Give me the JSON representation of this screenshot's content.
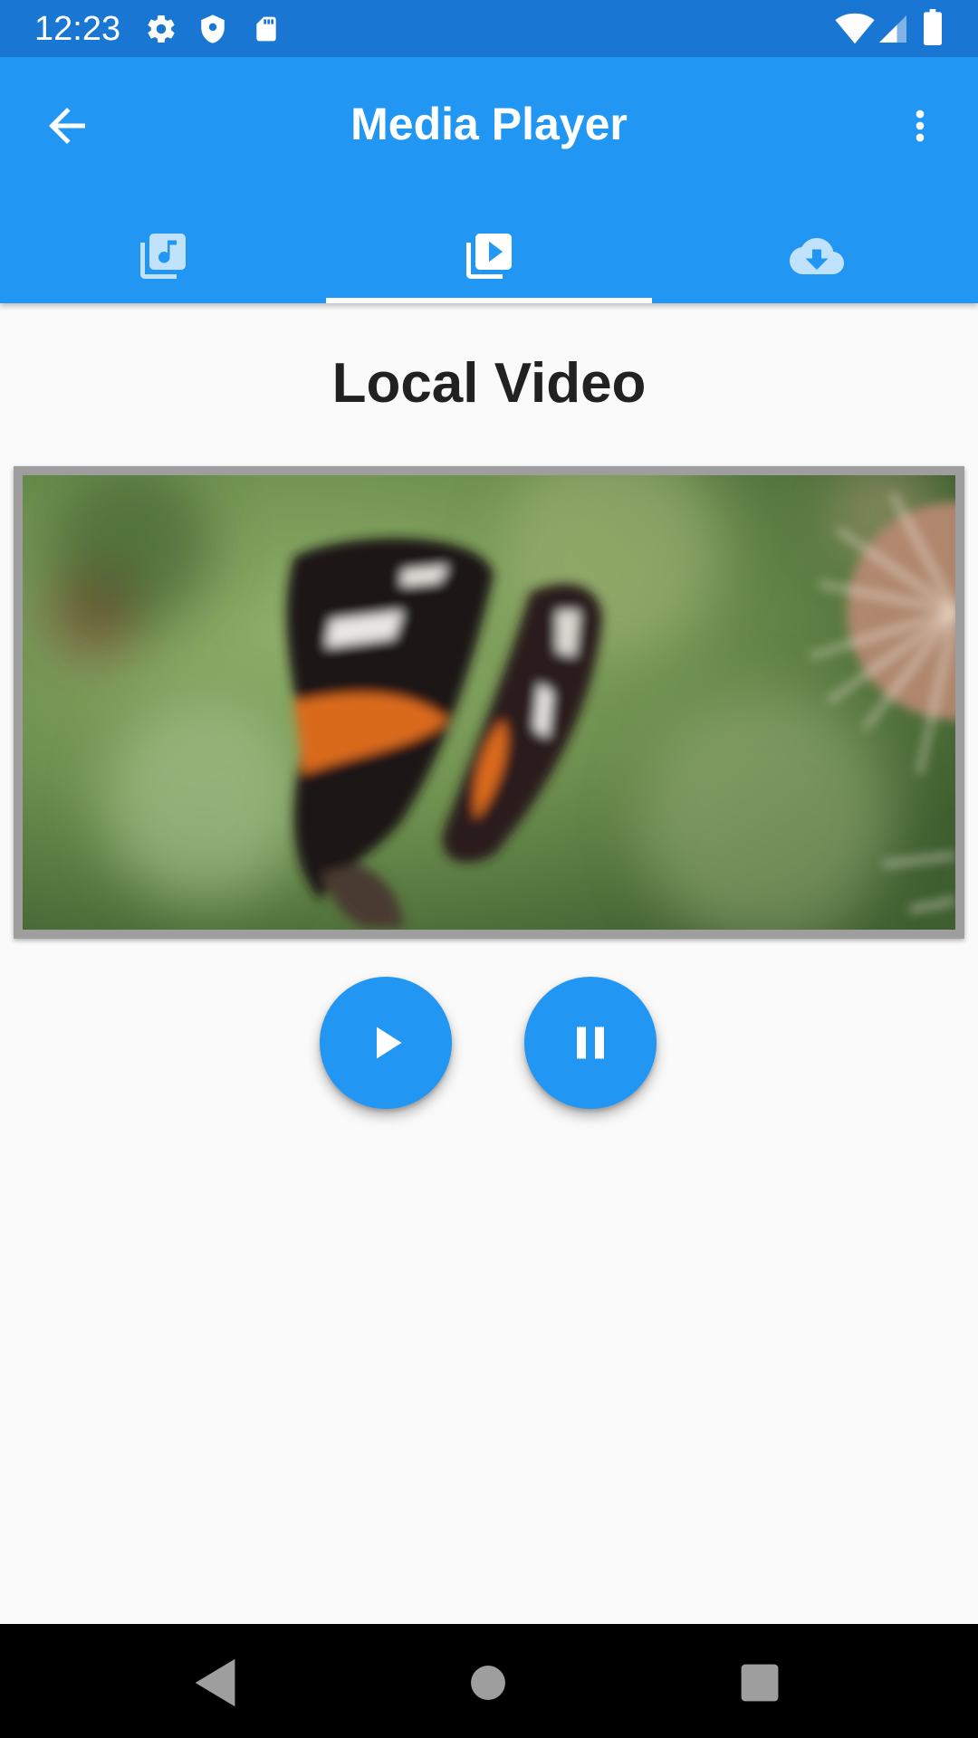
{
  "status_bar": {
    "time": "12:23",
    "icons": [
      "gear-icon",
      "shield-icon",
      "sd-card-icon",
      "wifi-icon",
      "signal-icon",
      "battery-icon"
    ],
    "background": "#1976d2"
  },
  "app_bar": {
    "title": "Media Player",
    "background": "#2196f3",
    "back_icon": "arrow-back-icon",
    "menu_icon": "more-vert-icon"
  },
  "tabs": [
    {
      "icon": "library-music-icon",
      "selected": false
    },
    {
      "icon": "video-library-icon",
      "selected": true
    },
    {
      "icon": "cloud-download-icon",
      "selected": false
    }
  ],
  "content": {
    "title": "Local Video",
    "video": {
      "subject": "butterfly-on-thistle"
    }
  },
  "controls": {
    "play_icon": "play-icon",
    "pause_icon": "pause-icon",
    "accent": "#2196f3"
  },
  "nav_bar": {
    "icons": [
      "back-triangle-icon",
      "home-circle-icon",
      "recents-square-icon"
    ]
  }
}
